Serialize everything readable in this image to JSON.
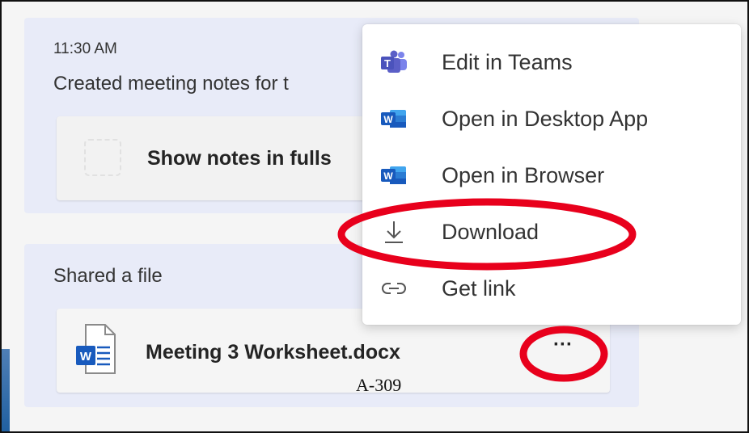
{
  "note_card": {
    "time": "11:30 AM",
    "description": "Created meeting notes for t",
    "button_label": "Show notes in fulls"
  },
  "file_card": {
    "shared_label": "Shared a file",
    "file_name": "Meeting 3 Worksheet.docx",
    "more_label": "···"
  },
  "context_menu": {
    "items": [
      {
        "label": "Edit in Teams",
        "icon": "teams-icon"
      },
      {
        "label": "Open in Desktop App",
        "icon": "word-icon"
      },
      {
        "label": "Open in Browser",
        "icon": "word-icon"
      },
      {
        "label": "Download",
        "icon": "download-icon"
      },
      {
        "label": "Get link",
        "icon": "link-icon"
      }
    ]
  },
  "reference_label": "A-309",
  "colors": {
    "card_bg": "#e8ebf8",
    "highlight_red": "#e8001c",
    "teams_purple": "#5b5fc7",
    "word_blue": "#185abd"
  }
}
